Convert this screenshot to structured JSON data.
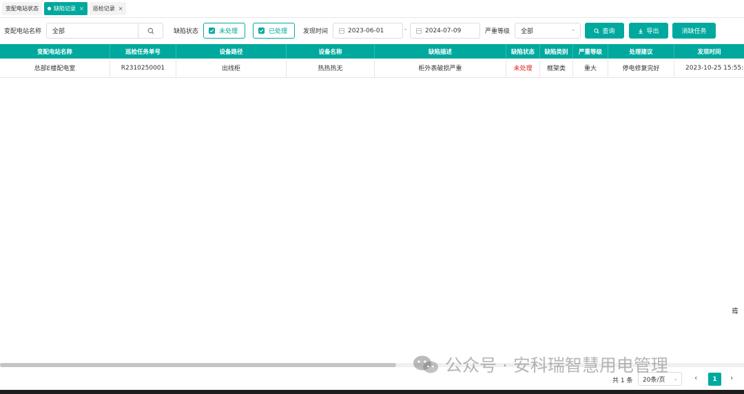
{
  "tabs": [
    {
      "label": "变配电站状态",
      "active": false,
      "closable": false
    },
    {
      "label": "缺陷记录",
      "active": true,
      "closable": true
    },
    {
      "label": "巡检记录",
      "active": false,
      "closable": true
    }
  ],
  "filters": {
    "station_label": "变配电站名称",
    "station_value": "全部",
    "defect_status_label": "缺陷状态",
    "status_unhandled": "未处理",
    "status_handled": "已处理",
    "time_label": "发现时间",
    "date_start": "2023-06-01",
    "date_sep": "-",
    "date_end": "2024-07-09",
    "severity_label": "严重等级",
    "severity_value": "全部"
  },
  "buttons": {
    "search": "查询",
    "export": "导出",
    "eliminate": "消缺任务"
  },
  "table": {
    "columns": [
      "变配电站名称",
      "巡检任务单号",
      "设备路径",
      "设备名称",
      "缺陷描述",
      "缺陷状态",
      "缺陷类别",
      "严重等级",
      "处理建议",
      "发现时间"
    ],
    "rows": [
      [
        "总部E楼配电室",
        "R2310250001",
        "出线柜",
        "热热热无",
        "柜外表破损严重",
        "未处理",
        "框架类",
        "重大",
        "停电修复完好",
        "2023-10-25 15:55:5"
      ]
    ]
  },
  "pagination": {
    "total": "共 1 条",
    "page_size": "20条/页",
    "current_page": "1"
  },
  "watermark": "公众号 · 安科瑞智慧用电管理",
  "colors": {
    "accent": "#00a99d",
    "unhandled": "#e02020"
  }
}
